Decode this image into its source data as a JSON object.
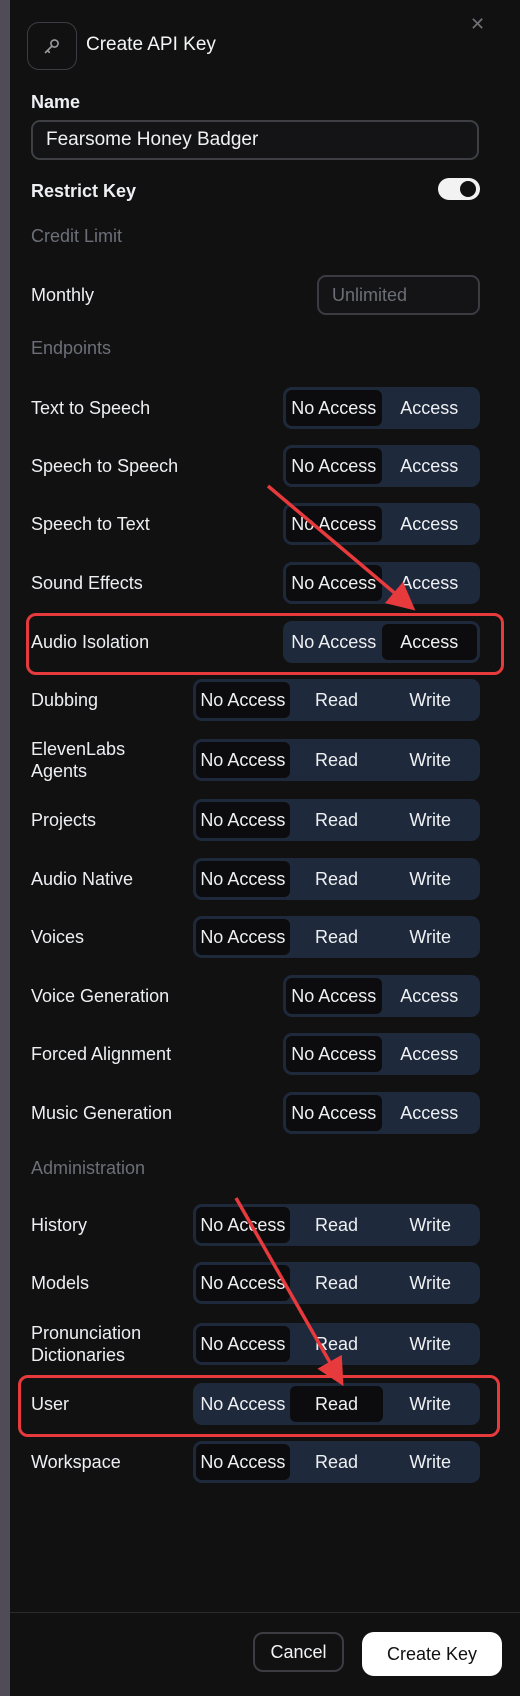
{
  "dialog": {
    "title": "Create API Key",
    "close_icon": "close-icon",
    "header_icon": "key-icon"
  },
  "name": {
    "label": "Name",
    "value": "Fearsome Honey Badger"
  },
  "restrict": {
    "label": "Restrict Key",
    "enabled": true
  },
  "credit_limit": {
    "section": "Credit Limit",
    "monthly_label": "Monthly",
    "monthly_placeholder": "Unlimited"
  },
  "endpoints": {
    "section": "Endpoints",
    "items": [
      {
        "label": "Text to Speech",
        "options": [
          "No Access",
          "Access"
        ],
        "selected": "No Access"
      },
      {
        "label": "Speech to Speech",
        "options": [
          "No Access",
          "Access"
        ],
        "selected": "No Access"
      },
      {
        "label": "Speech to Text",
        "options": [
          "No Access",
          "Access"
        ],
        "selected": "No Access"
      },
      {
        "label": "Sound Effects",
        "options": [
          "No Access",
          "Access"
        ],
        "selected": "No Access"
      },
      {
        "label": "Audio Isolation",
        "options": [
          "No Access",
          "Access"
        ],
        "selected": "Access"
      },
      {
        "label": "Dubbing",
        "options": [
          "No Access",
          "Read",
          "Write"
        ],
        "selected": "No Access"
      },
      {
        "label": "ElevenLabs Agents",
        "label_line1": "ElevenLabs",
        "label_line2": "Agents",
        "options": [
          "No Access",
          "Read",
          "Write"
        ],
        "selected": "No Access"
      },
      {
        "label": "Projects",
        "options": [
          "No Access",
          "Read",
          "Write"
        ],
        "selected": "No Access"
      },
      {
        "label": "Audio Native",
        "options": [
          "No Access",
          "Read",
          "Write"
        ],
        "selected": "No Access"
      },
      {
        "label": "Voices",
        "options": [
          "No Access",
          "Read",
          "Write"
        ],
        "selected": "No Access"
      },
      {
        "label": "Voice Generation",
        "options": [
          "No Access",
          "Access"
        ],
        "selected": "No Access"
      },
      {
        "label": "Forced Alignment",
        "options": [
          "No Access",
          "Access"
        ],
        "selected": "No Access"
      },
      {
        "label": "Music Generation",
        "options": [
          "No Access",
          "Access"
        ],
        "selected": "No Access"
      }
    ]
  },
  "administration": {
    "section": "Administration",
    "items": [
      {
        "label": "History",
        "options": [
          "No Access",
          "Read",
          "Write"
        ],
        "selected": "No Access"
      },
      {
        "label": "Models",
        "options": [
          "No Access",
          "Read",
          "Write"
        ],
        "selected": "No Access"
      },
      {
        "label": "Pronunciation Dictionaries",
        "label_line1": "Pronunciation",
        "label_line2": "Dictionaries",
        "options": [
          "No Access",
          "Read",
          "Write"
        ],
        "selected": "No Access"
      },
      {
        "label": "User",
        "options": [
          "No Access",
          "Read",
          "Write"
        ],
        "selected": "Read"
      },
      {
        "label": "Workspace",
        "options": [
          "No Access",
          "Read",
          "Write"
        ],
        "selected": "No Access"
      }
    ]
  },
  "footer": {
    "cancel_label": "Cancel",
    "create_label": "Create Key"
  },
  "colors": {
    "accent_annotation": "#e63a3d",
    "segment_bg": "#1e293b",
    "dialog_bg": "#111112"
  }
}
